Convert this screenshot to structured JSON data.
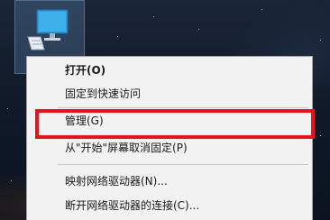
{
  "desktop": {
    "icon_name": "this-pc-icon"
  },
  "context_menu": {
    "items": [
      {
        "label": "打开(O)",
        "bold": true
      },
      {
        "label": "固定到快速访问",
        "bold": false
      },
      {
        "label": "管理(G)",
        "bold": false
      },
      {
        "label": "从\"开始\"屏幕取消固定(P)",
        "bold": false
      },
      {
        "label": "映射网络驱动器(N)...",
        "bold": false
      },
      {
        "label": "断开网络驱动器的连接(C)...",
        "bold": false
      }
    ],
    "highlighted_item": "管理(G)"
  },
  "colors": {
    "menu_background": "#f2f2f2",
    "highlight_border": "#e8141c",
    "text": "#1a1a1a"
  }
}
